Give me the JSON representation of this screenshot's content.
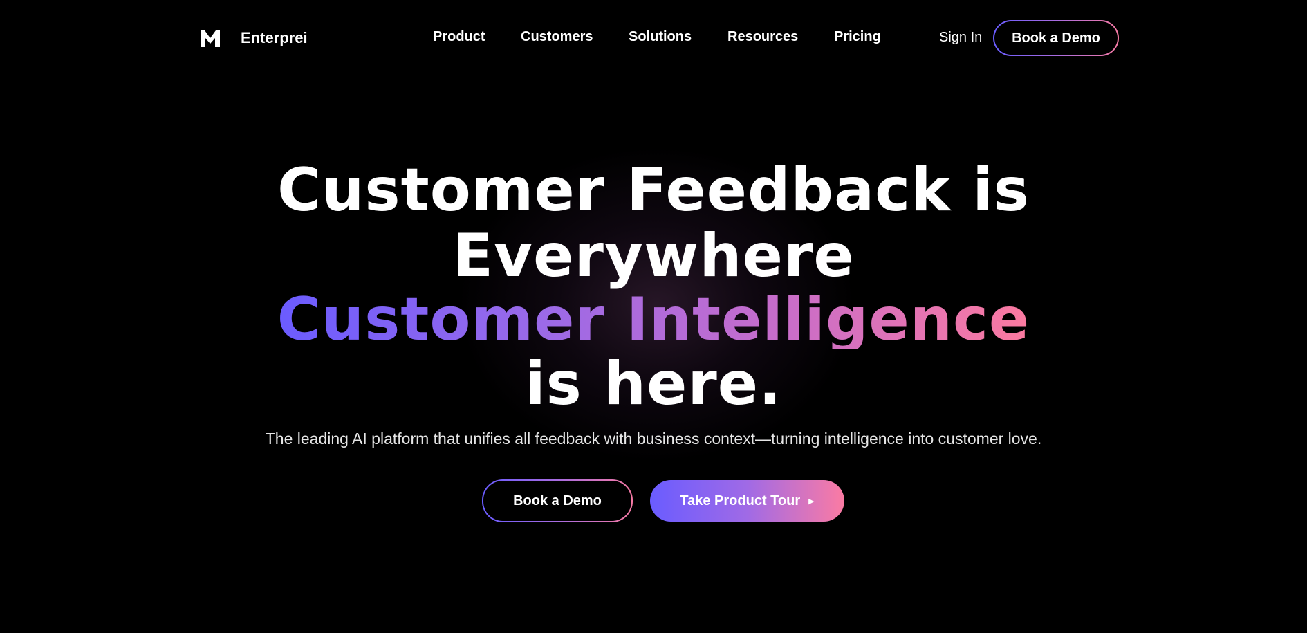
{
  "nav": {
    "brand": "Enterprei",
    "links": [
      {
        "label": "Product"
      },
      {
        "label": "Customers"
      },
      {
        "label": "Solutions"
      },
      {
        "label": "Resources"
      },
      {
        "label": "Pricing"
      }
    ],
    "sign_in": "Sign In",
    "demo_label": "Book a Demo"
  },
  "hero": {
    "line1": "Customer Feedback is",
    "line2": "Everywhere",
    "line3": "Customer Intelligence",
    "line4": "is here.",
    "subtitle": "The leading AI platform that unifies all feedback with business context—turning intelligence into customer love.",
    "primary_cta": "Book a Demo",
    "secondary_cta": "Take Product Tour",
    "secondary_icon": "play-triangle-icon"
  },
  "colors": {
    "background": "#000000",
    "gradient_start": "#6a5cff",
    "gradient_mid": "#a86ce0",
    "gradient_end": "#f77aa5",
    "text": "#ffffff"
  }
}
